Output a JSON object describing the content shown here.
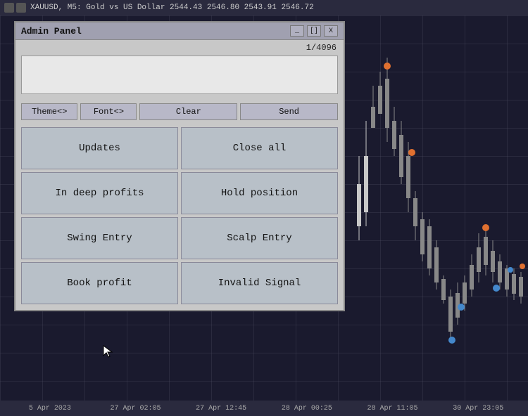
{
  "topbar": {
    "icons": [
      "chart-icon",
      "bar-icon"
    ],
    "title": "XAUUSD, M5: Gold vs US Dollar  2544.43 2546.80 2543.91 2546.72"
  },
  "adminPanel": {
    "title": "Admin Panel",
    "counter": "1/4096",
    "textarea_placeholder": "",
    "buttons": {
      "theme": "Theme<>",
      "font": "Font<>",
      "clear": "Clear",
      "send": "Send"
    },
    "gridButtons": [
      {
        "id": "updates",
        "label": "Updates"
      },
      {
        "id": "close-all",
        "label": "Close all"
      },
      {
        "id": "in-deep-profits",
        "label": "In deep profits"
      },
      {
        "id": "hold-position",
        "label": "Hold position"
      },
      {
        "id": "swing-entry",
        "label": "Swing Entry"
      },
      {
        "id": "scalp-entry",
        "label": "Scalp Entry"
      },
      {
        "id": "book-profit",
        "label": "Book profit"
      },
      {
        "id": "invalid-signal",
        "label": "Invalid Signal"
      }
    ],
    "titlebarControls": [
      "_",
      "[]",
      "X"
    ]
  },
  "timeline": {
    "labels": [
      "5 Apr 2023",
      "27 Apr 02:05",
      "27 Apr 12:45",
      "28 Apr 00:25",
      "28 Apr 11:05",
      "30 Apr 23:05"
    ]
  },
  "chart": {
    "color_up": "#e07030",
    "color_down": "#e07030",
    "dot_blue": "#4488cc",
    "dot_orange": "#e07030"
  }
}
